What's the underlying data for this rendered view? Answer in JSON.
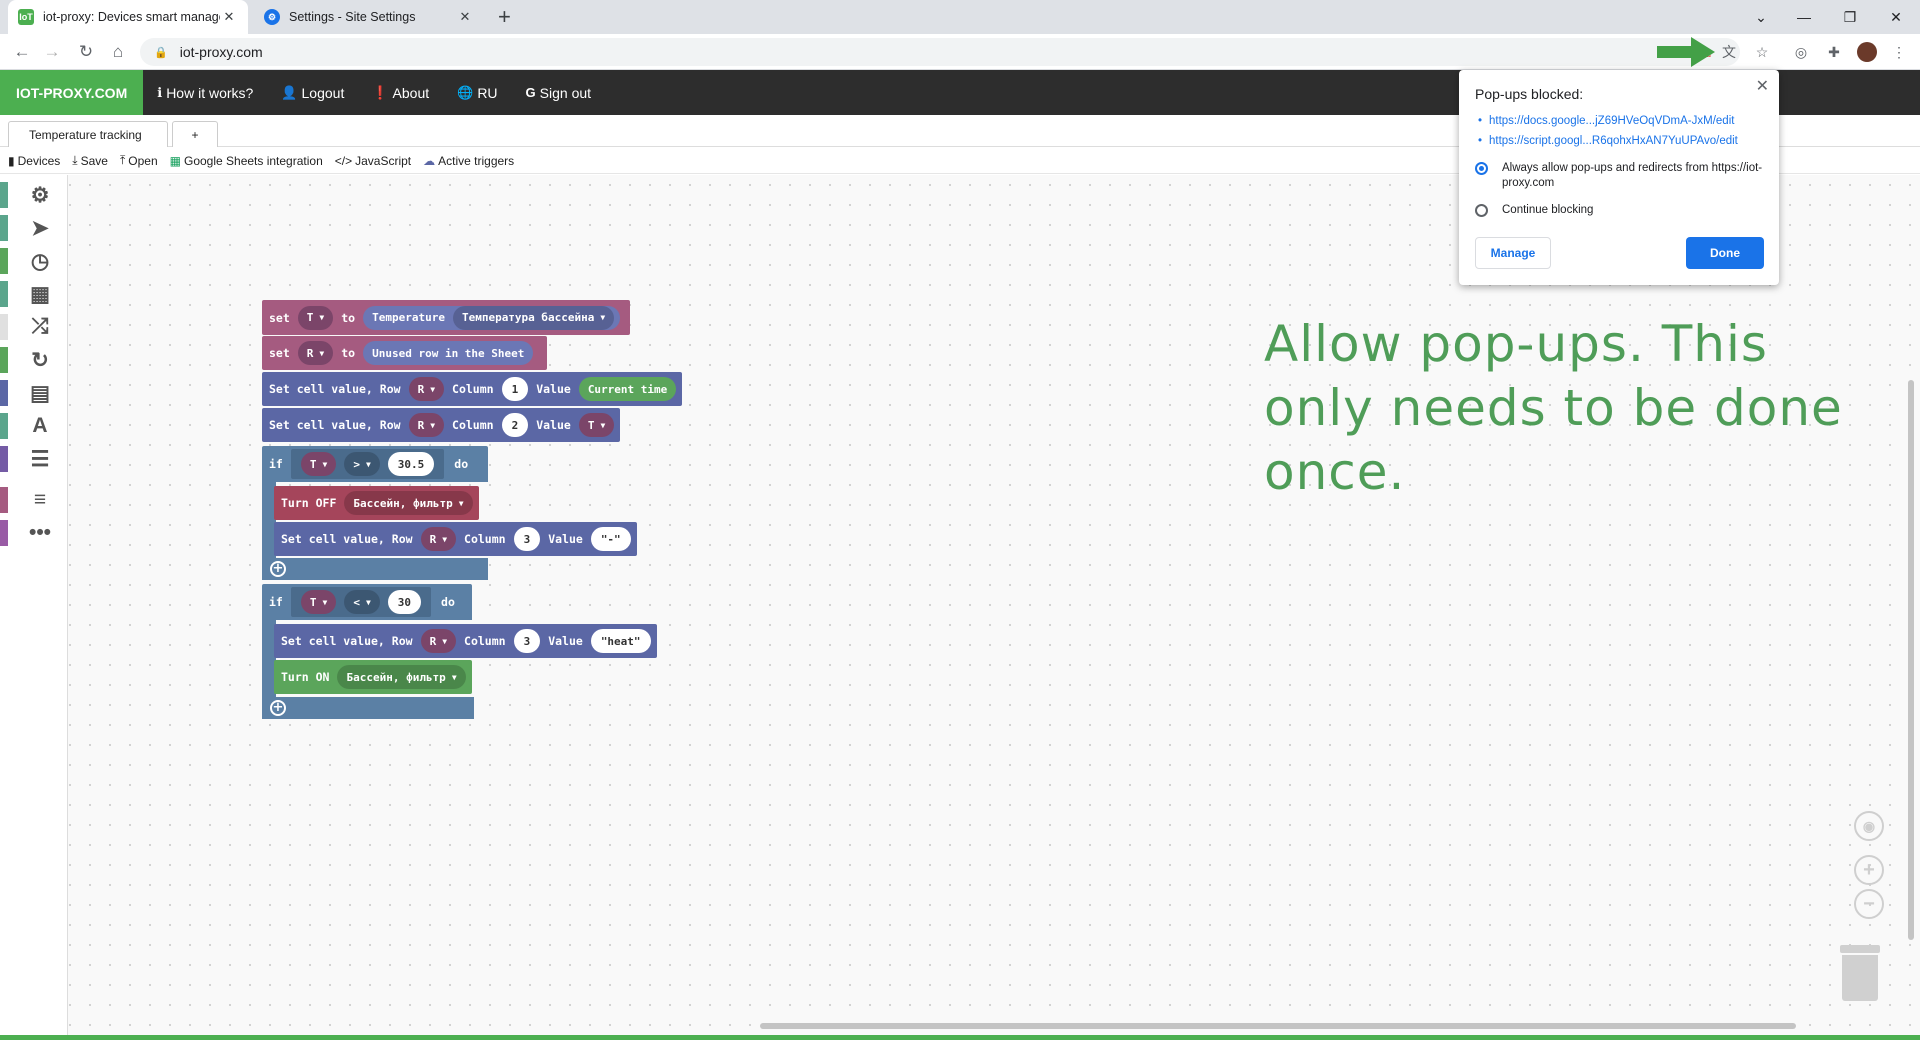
{
  "browser": {
    "tabs": [
      {
        "title": "iot-proxy: Devices smart manage",
        "favicon": "IoT",
        "active": true
      },
      {
        "title": "Settings - Site Settings",
        "favicon": "gear-icon",
        "active": false
      }
    ],
    "new_tab": "+",
    "url": "iot-proxy.com"
  },
  "appnav": {
    "brand": "IOT-PROXY.COM",
    "items": [
      {
        "icon": "info-icon",
        "label": "How it works?"
      },
      {
        "icon": "user-icon",
        "label": "Logout"
      },
      {
        "icon": "exclamation-icon",
        "label": "About"
      },
      {
        "icon": "globe-icon",
        "label": "RU"
      },
      {
        "icon": "google-icon",
        "label": "Sign out"
      }
    ]
  },
  "workspace_tabs": {
    "active": "Temperature tracking",
    "add": "+"
  },
  "actions": [
    {
      "icon": "device-icon",
      "label": "Devices"
    },
    {
      "icon": "save-icon",
      "label": "Save"
    },
    {
      "icon": "upload-icon",
      "label": "Open"
    },
    {
      "icon": "table-icon",
      "label": "Google Sheets integration"
    },
    {
      "icon": "code-icon",
      "label": "JavaScript"
    },
    {
      "icon": "cloud-icon",
      "label": "Active triggers"
    }
  ],
  "sidebar": [
    {
      "icon": "gears-icon",
      "color": "#5ba58c"
    },
    {
      "icon": "paper-plane-icon",
      "color": "#5ba58c"
    },
    {
      "icon": "clock-icon",
      "color": "#5ba55b"
    },
    {
      "icon": "table-icon",
      "color": "#5ba58c"
    },
    {
      "icon": "shuffle-icon",
      "color": "#e0e0e0"
    },
    {
      "icon": "redo-icon",
      "color": "#5ba55b"
    },
    {
      "icon": "calculator-icon",
      "color": "#5b67a5"
    },
    {
      "icon": "text-icon",
      "color": "#5ba58c"
    },
    {
      "icon": "list-icon",
      "color": "#745ba5"
    },
    {
      "icon": "variables-icon",
      "color": "#a55b80"
    },
    {
      "icon": "more-icon",
      "color": "#995ba5"
    }
  ],
  "blocks": {
    "set": "set",
    "to": "to",
    "var_t": "T",
    "var_r": "R",
    "temperature": "Temperature",
    "pool_temp": "Температура бассейна",
    "unused_row": "Unused row in the Sheet",
    "set_cell": "Set cell value, Row",
    "column": "Column",
    "value": "Value",
    "current_time": "Current time",
    "col1": "1",
    "col2": "2",
    "col3": "3",
    "if": "if",
    "do": "do",
    "gt": ">",
    "lt": "<",
    "threshold_high": "30.5",
    "threshold_low": "30",
    "turn_off": "Turn OFF",
    "turn_on": "Turn ON",
    "device": "Бассейн, фильтр",
    "val_dash": "\"-\"",
    "val_heat": "\"heat\""
  },
  "hint": "Allow pop-ups. This only needs to be done once.",
  "popup": {
    "title": "Pop-ups blocked:",
    "links": [
      "https://docs.google...jZ69HVeOqVDmA-JxM/edit",
      "https://script.googl...R6qohxHxAN7YuUPAvo/edit"
    ],
    "option_allow": "Always allow pop-ups and redirects from https://iot-proxy.com",
    "option_block": "Continue blocking",
    "manage": "Manage",
    "done": "Done"
  }
}
